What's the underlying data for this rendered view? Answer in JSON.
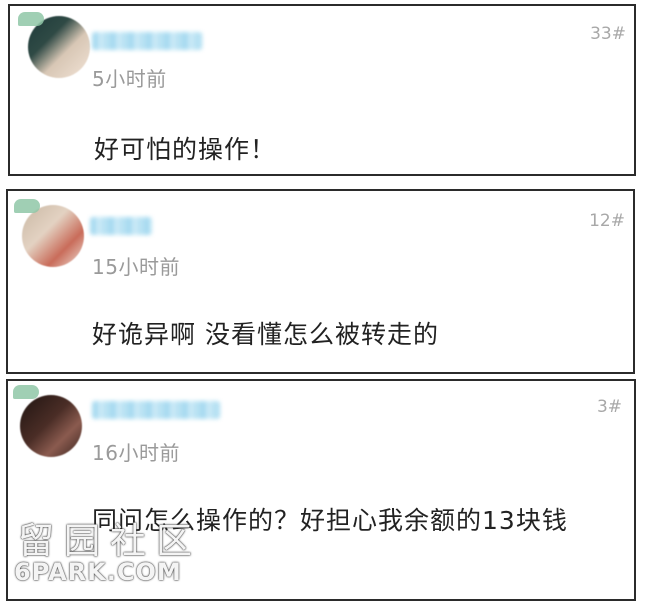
{
  "comments": [
    {
      "floor": "33#",
      "time": "5小时前",
      "text": "好可怕的操作！"
    },
    {
      "floor": "12#",
      "time": "15小时前",
      "text": "好诡异啊 没看懂怎么被转走的"
    },
    {
      "floor": "3#",
      "time": "16小时前",
      "text": "同问怎么操作的？好担心我余额的13块钱"
    }
  ],
  "watermark": {
    "cn": "留园社区",
    "en": "6PARK.COM"
  }
}
